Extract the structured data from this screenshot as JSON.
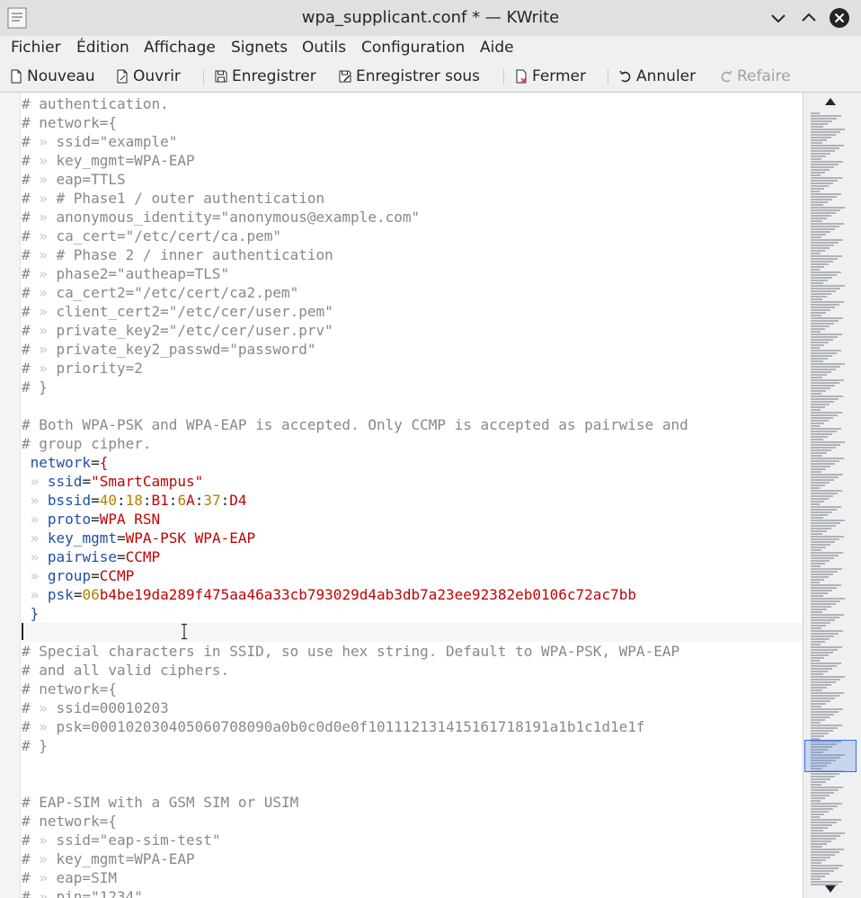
{
  "window": {
    "title": "wpa_supplicant.conf * — KWrite"
  },
  "menu": [
    "Fichier",
    "Édition",
    "Affichage",
    "Signets",
    "Outils",
    "Configuration",
    "Aide"
  ],
  "toolbar": {
    "nouveau": "Nouveau",
    "ouvrir": "Ouvrir",
    "enregistrer": "Enregistrer",
    "enregistrer_sous": "Enregistrer sous",
    "fermer": "Fermer",
    "annuler": "Annuler",
    "refaire": "Refaire"
  },
  "editor": {
    "lines": [
      [
        {
          "t": "# authentication.",
          "c": "comment"
        }
      ],
      [
        {
          "t": "# network={",
          "c": "comment"
        }
      ],
      [
        {
          "t": "# ",
          "c": "comment"
        },
        {
          "t": "» ",
          "c": "ws"
        },
        {
          "t": "ssid=\"example\"",
          "c": "comment"
        }
      ],
      [
        {
          "t": "# ",
          "c": "comment"
        },
        {
          "t": "» ",
          "c": "ws"
        },
        {
          "t": "key_mgmt=WPA-EAP",
          "c": "comment"
        }
      ],
      [
        {
          "t": "# ",
          "c": "comment"
        },
        {
          "t": "» ",
          "c": "ws"
        },
        {
          "t": "eap=TTLS",
          "c": "comment"
        }
      ],
      [
        {
          "t": "# ",
          "c": "comment"
        },
        {
          "t": "» ",
          "c": "ws"
        },
        {
          "t": "# Phase1 / outer authentication",
          "c": "comment"
        }
      ],
      [
        {
          "t": "# ",
          "c": "comment"
        },
        {
          "t": "» ",
          "c": "ws"
        },
        {
          "t": "anonymous_identity=\"anonymous@example.com\"",
          "c": "comment"
        }
      ],
      [
        {
          "t": "# ",
          "c": "comment"
        },
        {
          "t": "» ",
          "c": "ws"
        },
        {
          "t": "ca_cert=\"/etc/cert/ca.pem\"",
          "c": "comment"
        }
      ],
      [
        {
          "t": "# ",
          "c": "comment"
        },
        {
          "t": "» ",
          "c": "ws"
        },
        {
          "t": "# Phase 2 / inner authentication",
          "c": "comment"
        }
      ],
      [
        {
          "t": "# ",
          "c": "comment"
        },
        {
          "t": "» ",
          "c": "ws"
        },
        {
          "t": "phase2=\"autheap=TLS\"",
          "c": "comment"
        }
      ],
      [
        {
          "t": "# ",
          "c": "comment"
        },
        {
          "t": "» ",
          "c": "ws"
        },
        {
          "t": "ca_cert2=\"/etc/cert/ca2.pem\"",
          "c": "comment"
        }
      ],
      [
        {
          "t": "# ",
          "c": "comment"
        },
        {
          "t": "» ",
          "c": "ws"
        },
        {
          "t": "client_cert2=\"/etc/cer/user.pem\"",
          "c": "comment"
        }
      ],
      [
        {
          "t": "# ",
          "c": "comment"
        },
        {
          "t": "» ",
          "c": "ws"
        },
        {
          "t": "private_key2=\"/etc/cer/user.prv\"",
          "c": "comment"
        }
      ],
      [
        {
          "t": "# ",
          "c": "comment"
        },
        {
          "t": "» ",
          "c": "ws"
        },
        {
          "t": "private_key2_passwd=\"password\"",
          "c": "comment"
        }
      ],
      [
        {
          "t": "# ",
          "c": "comment"
        },
        {
          "t": "» ",
          "c": "ws"
        },
        {
          "t": "priority=2",
          "c": "comment"
        }
      ],
      [
        {
          "t": "# }",
          "c": "comment"
        }
      ],
      [
        {
          "t": "",
          "c": "comment"
        }
      ],
      [
        {
          "t": "# Both WPA-PSK and WPA-EAP is accepted. Only CCMP is accepted as pairwise and",
          "c": "comment"
        }
      ],
      [
        {
          "t": "# group cipher.",
          "c": "comment"
        }
      ],
      [
        {
          "t": " network",
          "c": "key"
        },
        {
          "t": "=",
          "c": "punct"
        },
        {
          "t": "{",
          "c": "str"
        }
      ],
      [
        {
          "t": " » ",
          "c": "ws"
        },
        {
          "t": "ssid",
          "c": "key"
        },
        {
          "t": "=",
          "c": "punct"
        },
        {
          "t": "\"SmartCampus\"",
          "c": "str"
        }
      ],
      [
        {
          "t": " » ",
          "c": "ws"
        },
        {
          "t": "bssid",
          "c": "key"
        },
        {
          "t": "=",
          "c": "punct"
        },
        {
          "t": "40",
          "c": "num"
        },
        {
          "t": ":",
          "c": "punct"
        },
        {
          "t": "18",
          "c": "num"
        },
        {
          "t": ":",
          "c": "punct"
        },
        {
          "t": "B1",
          "c": "val"
        },
        {
          "t": ":",
          "c": "punct"
        },
        {
          "t": "6",
          "c": "num"
        },
        {
          "t": "A",
          "c": "val"
        },
        {
          "t": ":",
          "c": "punct"
        },
        {
          "t": "37",
          "c": "num"
        },
        {
          "t": ":",
          "c": "punct"
        },
        {
          "t": "D4",
          "c": "val"
        }
      ],
      [
        {
          "t": " » ",
          "c": "ws"
        },
        {
          "t": "proto",
          "c": "key"
        },
        {
          "t": "=",
          "c": "punct"
        },
        {
          "t": "WPA RSN",
          "c": "val"
        }
      ],
      [
        {
          "t": " » ",
          "c": "ws"
        },
        {
          "t": "key_mgmt",
          "c": "key"
        },
        {
          "t": "=",
          "c": "punct"
        },
        {
          "t": "WPA-PSK WPA-EAP",
          "c": "val"
        }
      ],
      [
        {
          "t": " » ",
          "c": "ws"
        },
        {
          "t": "pairwise",
          "c": "key"
        },
        {
          "t": "=",
          "c": "punct"
        },
        {
          "t": "CCMP",
          "c": "val"
        }
      ],
      [
        {
          "t": " » ",
          "c": "ws"
        },
        {
          "t": "group",
          "c": "key"
        },
        {
          "t": "=",
          "c": "punct"
        },
        {
          "t": "CCMP",
          "c": "val"
        }
      ],
      [
        {
          "t": " » ",
          "c": "ws"
        },
        {
          "t": "psk",
          "c": "key"
        },
        {
          "t": "=",
          "c": "punct"
        },
        {
          "t": "06",
          "c": "num"
        },
        {
          "t": "b4be19da289f475aa46a33cb793029d4ab3db7a23ee92382eb0106c72ac7bb",
          "c": "val"
        }
      ],
      [
        {
          "t": " }",
          "c": "brace"
        }
      ],
      [
        {
          "t": "",
          "c": "comment"
        }
      ],
      [
        {
          "t": "# Special characters in SSID, so use hex string. Default to WPA-PSK, WPA-EAP",
          "c": "comment"
        }
      ],
      [
        {
          "t": "# and all valid ciphers.",
          "c": "comment"
        }
      ],
      [
        {
          "t": "# network={",
          "c": "comment"
        }
      ],
      [
        {
          "t": "# ",
          "c": "comment"
        },
        {
          "t": "» ",
          "c": "ws"
        },
        {
          "t": "ssid=00010203",
          "c": "comment"
        }
      ],
      [
        {
          "t": "# ",
          "c": "comment"
        },
        {
          "t": "» ",
          "c": "ws"
        },
        {
          "t": "psk=000102030405060708090a0b0c0d0e0f101112131415161718191a1b1c1d1e1f",
          "c": "comment"
        }
      ],
      [
        {
          "t": "# }",
          "c": "comment"
        }
      ],
      [
        {
          "t": "",
          "c": "comment"
        }
      ],
      [
        {
          "t": "",
          "c": "comment"
        }
      ],
      [
        {
          "t": "# EAP-SIM with a GSM SIM or USIM",
          "c": "comment"
        }
      ],
      [
        {
          "t": "# network={",
          "c": "comment"
        }
      ],
      [
        {
          "t": "# ",
          "c": "comment"
        },
        {
          "t": "» ",
          "c": "ws"
        },
        {
          "t": "ssid=\"eap-sim-test\"",
          "c": "comment"
        }
      ],
      [
        {
          "t": "# ",
          "c": "comment"
        },
        {
          "t": "» ",
          "c": "ws"
        },
        {
          "t": "key_mgmt=WPA-EAP",
          "c": "comment"
        }
      ],
      [
        {
          "t": "# ",
          "c": "comment"
        },
        {
          "t": "» ",
          "c": "ws"
        },
        {
          "t": "eap=SIM",
          "c": "comment"
        }
      ],
      [
        {
          "t": "# ",
          "c": "comment"
        },
        {
          "t": "» ",
          "c": "ws"
        },
        {
          "t": "pin=\"1234\"",
          "c": "comment"
        }
      ]
    ],
    "current_line": 28
  }
}
